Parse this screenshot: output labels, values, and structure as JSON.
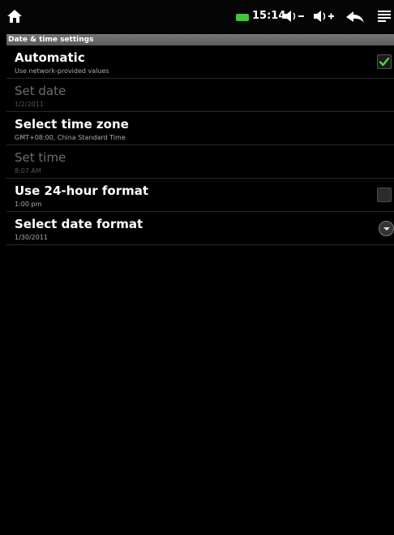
{
  "status_bar": {
    "time": "15:14",
    "battery_color": "#41c43f",
    "icons": [
      "home-icon",
      "battery-icon",
      "volume-down-icon",
      "volume-up-icon",
      "back-icon",
      "menu-icon"
    ]
  },
  "header": {
    "title": "Date & time settings"
  },
  "settings": [
    {
      "title": "Automatic",
      "summary": "Use network-provided values",
      "enabled": true,
      "control": "checkbox",
      "checked": true
    },
    {
      "title": "Set date",
      "summary": "1/2/2011",
      "enabled": false,
      "control": "none"
    },
    {
      "title": "Select time zone",
      "summary": "GMT+08:00, China Standard Time",
      "enabled": true,
      "control": "none"
    },
    {
      "title": "Set time",
      "summary": "8:07 AM",
      "enabled": false,
      "control": "none"
    },
    {
      "title": "Use 24-hour format",
      "summary": "1:00 pm",
      "enabled": true,
      "control": "checkbox",
      "checked": false
    },
    {
      "title": "Select date format",
      "summary": "1/30/2011",
      "enabled": true,
      "control": "dropdown"
    }
  ]
}
